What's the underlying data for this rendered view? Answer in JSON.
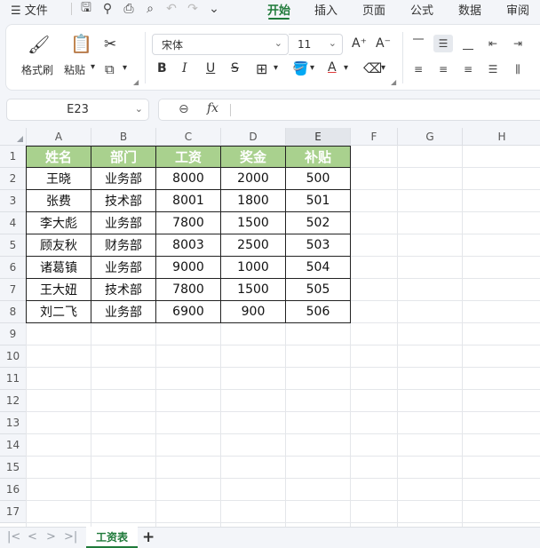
{
  "menubar": {
    "file_label": "☰ 文件",
    "tabs": [
      {
        "label": "开始"
      },
      {
        "label": "插入"
      },
      {
        "label": "页面"
      },
      {
        "label": "公式"
      },
      {
        "label": "数据"
      },
      {
        "label": "审阅"
      }
    ],
    "active_tab": "开始",
    "quick_icons": [
      "save-icon",
      "format-painter-icon",
      "print-icon",
      "print-preview-icon",
      "undo-icon",
      "redo-icon",
      "more-icon"
    ]
  },
  "ribbon": {
    "format_painter_label": "格式刷",
    "paste_label": "粘贴",
    "font_name": "宋体",
    "font_size": "11",
    "icons": {
      "cut": "scissors-icon",
      "copy": "copy-icon",
      "grow_font": "A⁺",
      "shrink_font": "A⁻"
    }
  },
  "formula_bar": {
    "name_box": "E23",
    "formula": ""
  },
  "sheet": {
    "columns": [
      "A",
      "B",
      "C",
      "D",
      "E",
      "F",
      "G",
      "H"
    ],
    "selected_column": "E",
    "rows": [
      "1",
      "2",
      "3",
      "4",
      "5",
      "6",
      "7",
      "8",
      "9",
      "10",
      "11",
      "12",
      "13",
      "14",
      "15",
      "16",
      "17"
    ],
    "table": {
      "header": [
        "姓名",
        "部门",
        "工资",
        "奖金",
        "补贴"
      ],
      "body": [
        [
          "王晓",
          "业务部",
          "8000",
          "2000",
          "500"
        ],
        [
          "张费",
          "技术部",
          "8001",
          "1800",
          "501"
        ],
        [
          "李大彪",
          "业务部",
          "7800",
          "1500",
          "502"
        ],
        [
          "顾友秋",
          "财务部",
          "8003",
          "2500",
          "503"
        ],
        [
          "诸葛镇",
          "业务部",
          "9000",
          "1000",
          "504"
        ],
        [
          "王大妞",
          "技术部",
          "7800",
          "1500",
          "505"
        ],
        [
          "刘二飞",
          "业务部",
          "6900",
          "900",
          "506"
        ]
      ],
      "header_color": "#a9d18e"
    }
  },
  "sheet_tabs": {
    "tabs": [
      {
        "label": "工资表"
      }
    ],
    "add_label": "+"
  },
  "colors": {
    "accent": "#1f7a3a"
  }
}
